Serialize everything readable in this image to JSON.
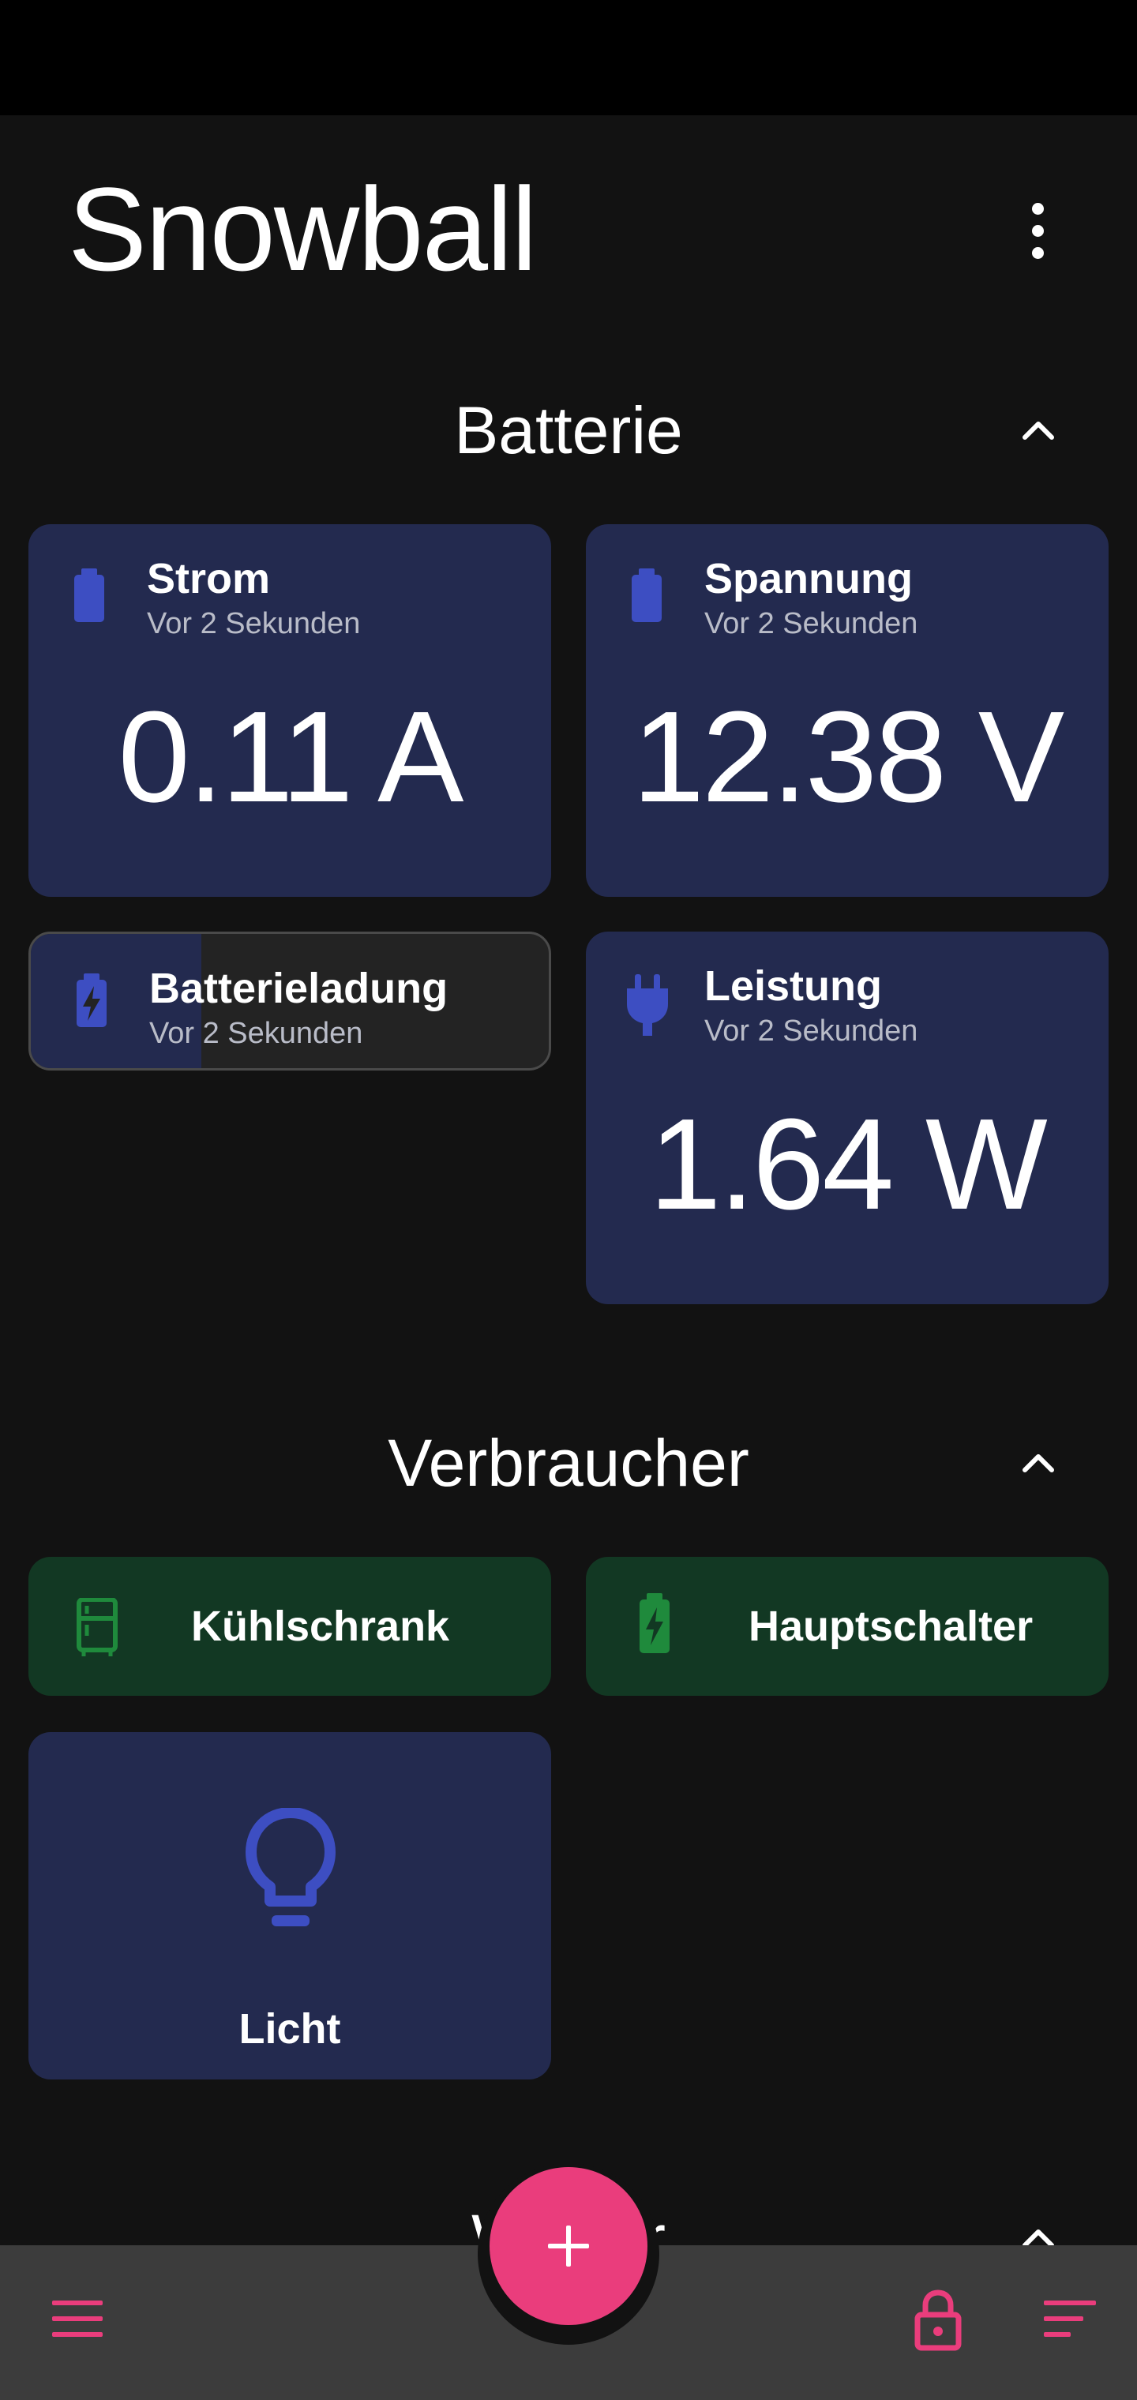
{
  "app": {
    "title": "Snowball"
  },
  "sections": {
    "batterie": {
      "title": "Batterie",
      "cards": [
        {
          "label": "Strom",
          "time": "Vor 2 Sekunden",
          "value": "0.11 A",
          "icon": "battery-icon"
        },
        {
          "label": "Spannung",
          "time": "Vor 2 Sekunden",
          "value": "12.38 V",
          "icon": "battery-icon"
        },
        {
          "label": "Batterieladung",
          "time": "Vor 2 Sekunden",
          "icon": "battery-charging-icon",
          "level_fraction": 0.33
        },
        {
          "label": "Leistung",
          "time": "Vor 2 Sekunden",
          "value": "1.64 W",
          "icon": "plug-icon"
        }
      ]
    },
    "verbraucher": {
      "title": "Verbraucher",
      "devices": [
        {
          "label": "Kühlschrank",
          "icon": "fridge-icon"
        },
        {
          "label": "Hauptschalter",
          "icon": "battery-charging-icon"
        },
        {
          "label": "Licht",
          "icon": "lightbulb-icon"
        }
      ]
    },
    "next": {
      "title": "Wetter"
    }
  },
  "colors": {
    "background": "#121212",
    "card_blue": "#232a4f",
    "card_green": "#123823",
    "icon_blue": "#3d4ec2",
    "icon_green": "#1f8a3c",
    "accent": "#ea3d7c"
  }
}
